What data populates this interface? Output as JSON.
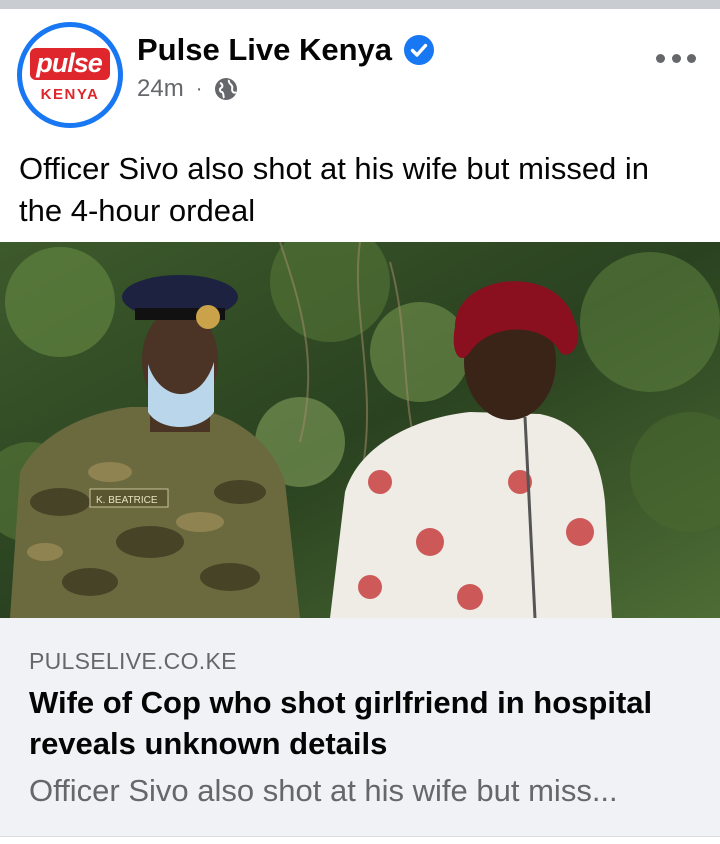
{
  "page": {
    "name": "Pulse Live Kenya",
    "logo_word": "pulse",
    "logo_sub": "KENYA",
    "timestamp": "24m",
    "meta_separator": "·",
    "privacy_icon": "globe-icon",
    "verified_icon": "verified-badge-icon"
  },
  "post": {
    "text": "Officer Sivo also shot at his wife but missed in the 4-hour ordeal"
  },
  "image": {
    "caption_left": "K. BEATRICE"
  },
  "link": {
    "domain": "PULSELIVE.CO.KE",
    "title": "Wife of Cop who shot girlfriend in hospital reveals unknown details",
    "description": "Officer Sivo also shot at his wife but miss..."
  },
  "colors": {
    "accent": "#1877f2",
    "brand": "#e0262d",
    "secondary_text": "#65676b",
    "card_bg": "#f0f2f5"
  }
}
